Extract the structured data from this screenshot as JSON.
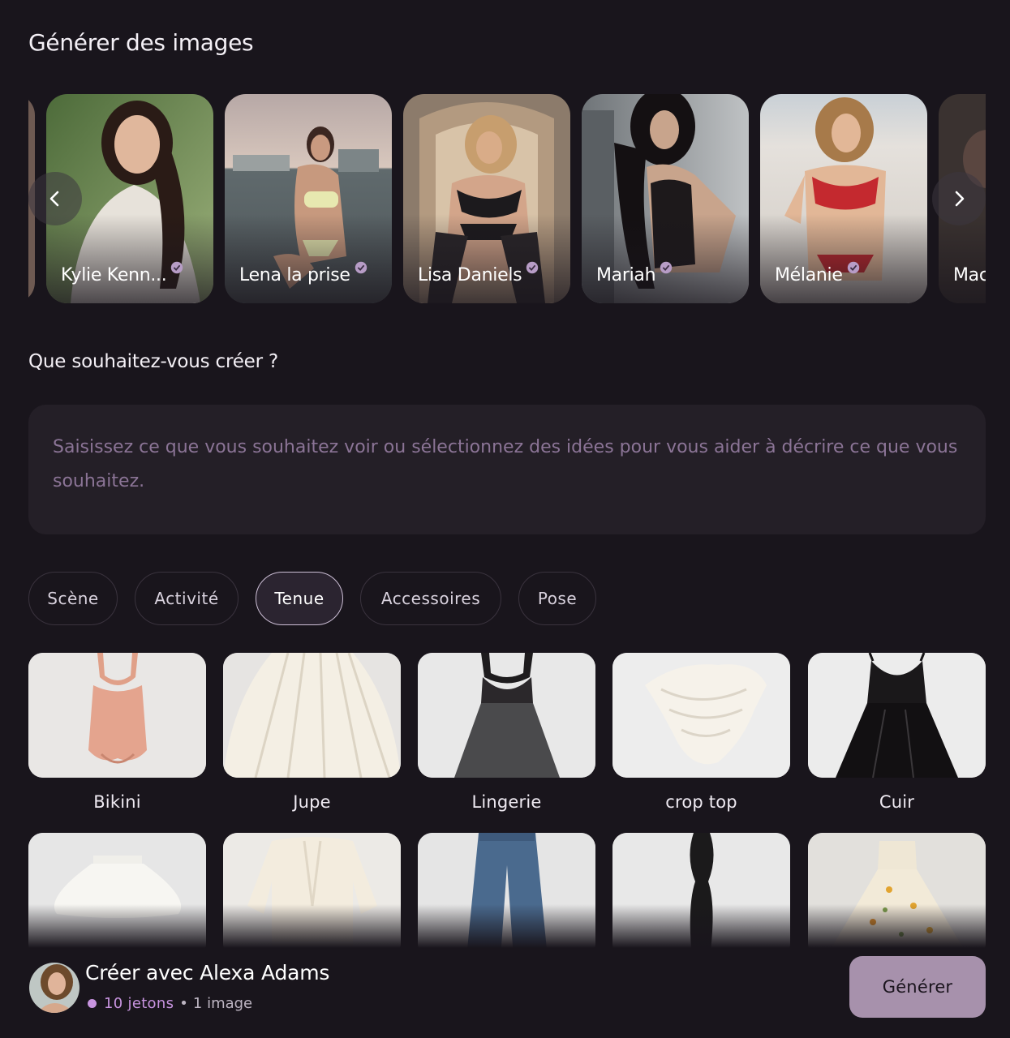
{
  "header": {
    "title": "Générer des images"
  },
  "carousel": {
    "prev_icon": "chevron-left-icon",
    "next_icon": "chevron-right-icon",
    "verified_icon": "verified-badge-icon",
    "characters": [
      {
        "name": "Kylie Kenn..."
      },
      {
        "name": "Lena la prise"
      },
      {
        "name": "Lisa Daniels"
      },
      {
        "name": "Mariah"
      },
      {
        "name": "Mélanie"
      },
      {
        "name": "Mac"
      }
    ]
  },
  "prompt": {
    "question": "Que souhaitez-vous créer ?",
    "placeholder": "Saisissez ce que vous souhaitez voir ou sélectionnez des idées pour vous aider à décrire ce que vous souhaitez."
  },
  "categories": {
    "active": "Tenue",
    "tabs": [
      "Scène",
      "Activité",
      "Tenue",
      "Accessoires",
      "Pose"
    ]
  },
  "outfits": {
    "row1": [
      "Bikini",
      "Jupe",
      "Lingerie",
      "crop top",
      "Cuir"
    ]
  },
  "footer": {
    "title": "Créer avec Alexa Adams",
    "tokens": "10 jetons",
    "separator": "•",
    "images": "1 image",
    "generate_label": "Générer"
  },
  "colors": {
    "background": "#19151c",
    "panel": "#241f27",
    "accent": "#c894e0",
    "button": "#a791ac",
    "placeholder": "#8b7496"
  }
}
